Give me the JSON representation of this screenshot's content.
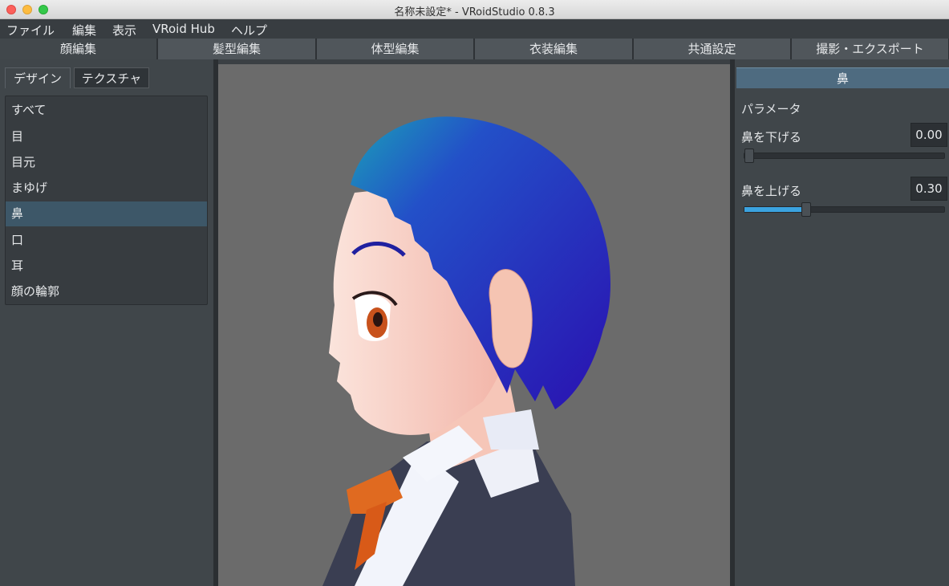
{
  "window": {
    "title": "名称未設定* - VRoidStudio 0.8.3"
  },
  "menubar": {
    "items": [
      {
        "label": "ファイル"
      },
      {
        "label": "編集"
      },
      {
        "label": "表示"
      },
      {
        "label": "VRoid Hub"
      },
      {
        "label": "ヘルプ"
      }
    ]
  },
  "main_tabs": [
    {
      "label": "顔編集",
      "active": true
    },
    {
      "label": "髪型編集"
    },
    {
      "label": "体型編集"
    },
    {
      "label": "衣装編集"
    },
    {
      "label": "共通設定"
    },
    {
      "label": "撮影・エクスポート"
    }
  ],
  "left_panel": {
    "tabs": [
      {
        "label": "デザイン",
        "active": true
      },
      {
        "label": "テクスチャ"
      }
    ],
    "categories": [
      {
        "label": "すべて"
      },
      {
        "label": "目"
      },
      {
        "label": "目元"
      },
      {
        "label": "まゆげ"
      },
      {
        "label": "鼻",
        "selected": true
      },
      {
        "label": "口"
      },
      {
        "label": "耳"
      },
      {
        "label": "顔の輪郭"
      }
    ]
  },
  "right_panel": {
    "header": "鼻",
    "section_title": "パラメータ",
    "params": [
      {
        "label": "鼻を下げる",
        "value": "0.00",
        "fraction": 0.0
      },
      {
        "label": "鼻を上げる",
        "value": "0.30",
        "fraction": 0.3
      }
    ]
  },
  "colors": {
    "accent": "#3ba3e0",
    "selection": "#3d5768",
    "panel_header": "#4e6b80",
    "viewport_bg": "#6b6b6b",
    "hair": "#2a1fb8"
  }
}
